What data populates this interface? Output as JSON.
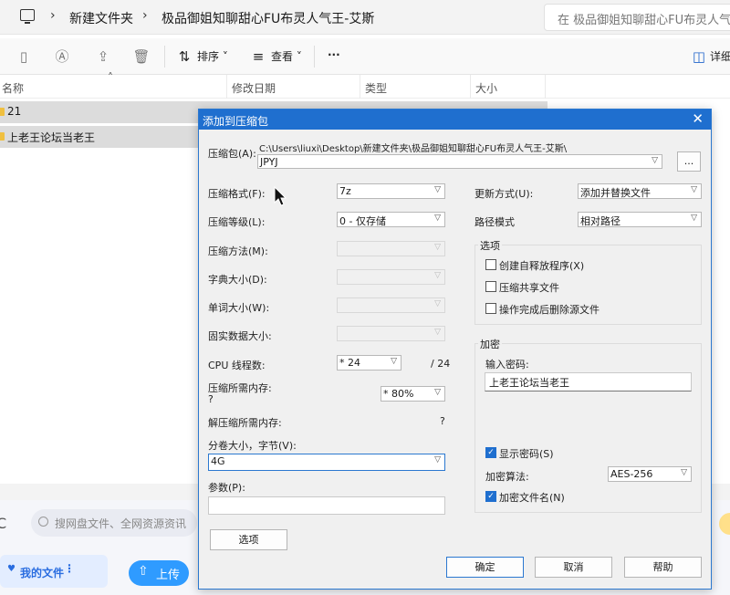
{
  "address": {
    "crumbs": [
      "新建文件夹",
      "极品御姐知聊甜心FU布灵人气王-艾斯"
    ],
    "search_placeholder": "在 极品御姐知聊甜心FU布灵人气"
  },
  "toolbar": {
    "sort_label": "排序",
    "view_label": "查看",
    "more_label": "···",
    "details_label": "详细"
  },
  "columns": {
    "name": "名称",
    "modified": "修改日期",
    "type": "类型",
    "size": "大小"
  },
  "files": [
    {
      "name": "21"
    },
    {
      "name": "上老王论坛当老王"
    }
  ],
  "netdisk": {
    "search_placeholder": "搜网盘文件、全网资源资讯",
    "my_files_label": "我的文件",
    "upload_label": "上传"
  },
  "dialog": {
    "title": "添加到压缩包",
    "archive_label": "压缩包(A):",
    "archive_path": "C:\\Users\\liuxi\\Desktop\\新建文件夹\\极品御姐知聊甜心FU布灵人气王-艾斯\\",
    "archive_name": "JPYJ",
    "browse_label": "...",
    "format_label": "压缩格式(F):",
    "format_value": "7z",
    "level_label": "压缩等级(L):",
    "level_value": "0 - 仅存储",
    "method_label": "压缩方法(M):",
    "dict_label": "字典大小(D):",
    "word_label": "单词大小(W):",
    "solid_label": "固实数据大小:",
    "cpu_label": "CPU 线程数:",
    "cpu_value": "* 24",
    "cpu_total": "/ 24",
    "mem_label": "压缩所需内存:",
    "mem_q": "?",
    "mem_value": "* 80%",
    "decomp_label": "解压缩所需内存:",
    "decomp_q": "?",
    "volume_label": "分卷大小，字节(V):",
    "volume_value": "4G",
    "params_label": "参数(P):",
    "options_button": "选项",
    "update_label": "更新方式(U):",
    "update_value": "添加并替换文件",
    "path_label": "路径模式",
    "path_value": "相对路径",
    "options_group": "选项",
    "opt_sfx": "创建自释放程序(X)",
    "opt_shared": "压缩共享文件",
    "opt_delete": "操作完成后删除源文件",
    "enc_group": "加密",
    "pwd_label": "输入密码:",
    "pwd_value": "上老王论坛当老王",
    "show_pwd": "显示密码(S)",
    "enc_method_label": "加密算法:",
    "enc_method_value": "AES-256",
    "enc_names": "加密文件名(N)",
    "ok": "确定",
    "cancel": "取消",
    "help": "帮助"
  }
}
